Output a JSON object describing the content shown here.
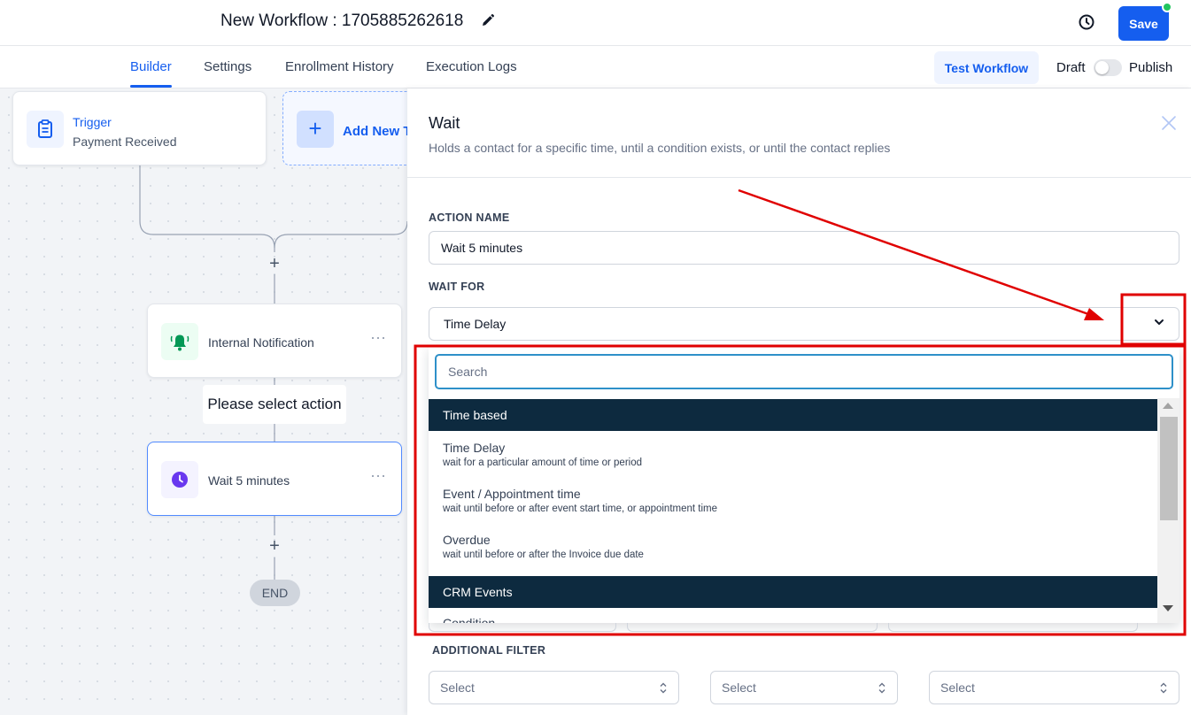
{
  "header": {
    "workflow_title": "New Workflow : 1705885262618",
    "save_label": "Save"
  },
  "tabs": [
    {
      "label": "Builder",
      "active": true
    },
    {
      "label": "Settings"
    },
    {
      "label": "Enrollment History"
    },
    {
      "label": "Execution Logs"
    }
  ],
  "toolbar": {
    "test_workflow_label": "Test Workflow",
    "draft_label": "Draft",
    "publish_label": "Publish",
    "published": false
  },
  "canvas": {
    "trigger": {
      "title": "Trigger",
      "subtitle": "Payment Received"
    },
    "add_new_trigger_label": "Add New T",
    "plus": "+",
    "internal_notification_label": "Internal Notification",
    "tooltip": "Please select action",
    "wait_node_label": "Wait 5 minutes",
    "end_label": "END",
    "more_glyph": "⋯"
  },
  "panel": {
    "title": "Wait",
    "description": "Holds a contact for a specific time, until a condition exists, or until the contact replies",
    "action_name_label": "ACTION NAME",
    "action_name_value": "Wait 5 minutes",
    "wait_for_label": "WAIT FOR",
    "wait_for_value": "Time Delay",
    "search_placeholder": "Search",
    "groups": [
      {
        "header": "Time based",
        "items": [
          {
            "title": "Time Delay",
            "subtitle": "wait for a particular amount of time or period"
          },
          {
            "title": "Event / Appointment time",
            "subtitle": "wait until before or after event start time, or appointment time"
          },
          {
            "title": "Overdue",
            "subtitle": "wait until before or after the Invoice due date"
          }
        ]
      },
      {
        "header": "CRM Events",
        "items": [
          {
            "title": "Condition",
            "subtitle": ""
          }
        ]
      }
    ],
    "additional_filter_label": "ADDITIONAL FILTER",
    "filter_selects": [
      "Select",
      "Select",
      "Select"
    ]
  },
  "colors": {
    "primary": "#155eef",
    "annotation_red": "#e00000",
    "dropdown_header": "#0d2a3f",
    "status_dot": "#22c55e"
  },
  "icons": [
    "edit-icon",
    "history-icon",
    "clipboard-icon",
    "plus-icon",
    "bell-icon",
    "clock-icon",
    "close-icon",
    "chevron-down-icon",
    "updown-chevron-icon"
  ]
}
